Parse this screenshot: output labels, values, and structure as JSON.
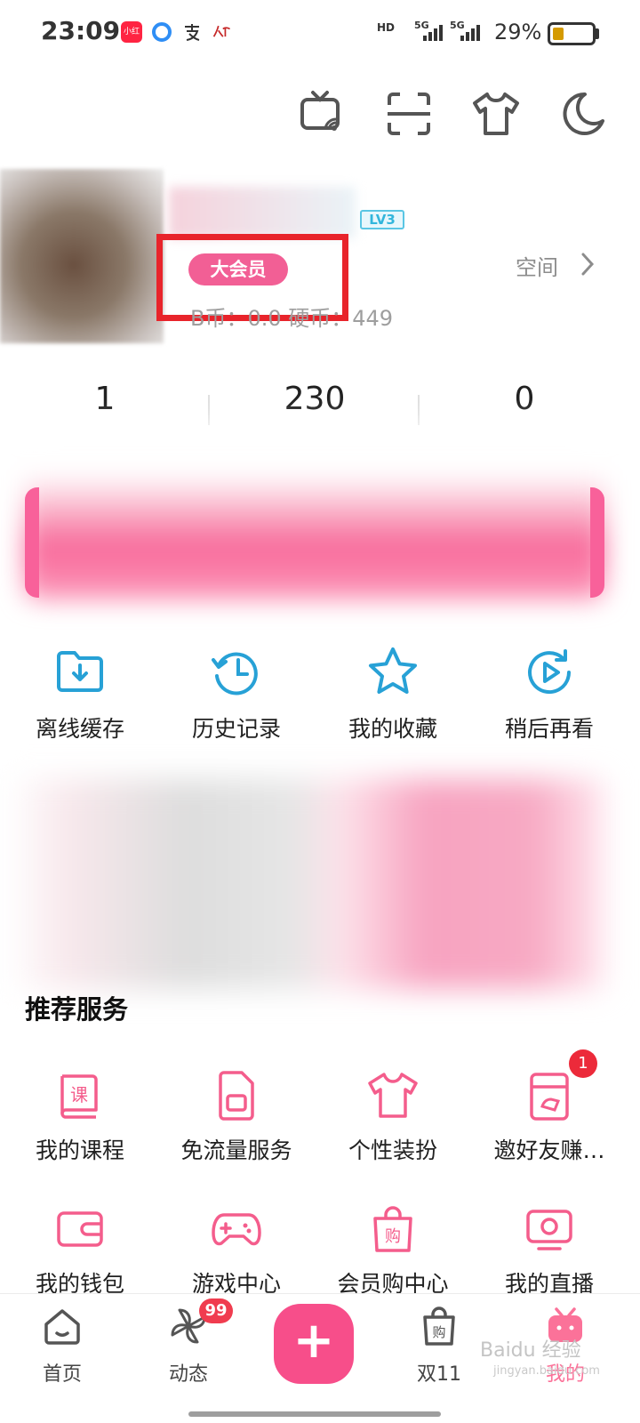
{
  "status_bar": {
    "time": "23:09",
    "battery_percent": "29%",
    "battery_level": 0.29,
    "network": [
      "HD",
      "5G",
      "5G"
    ],
    "notification_apps": [
      "小红书",
      "browser-icon",
      "alipay-icon",
      "people-daily-icon"
    ]
  },
  "top_tools": {
    "icons": [
      "tv-cast-icon",
      "scan-icon",
      "theme-shirt-icon",
      "night-mode-icon"
    ]
  },
  "profile": {
    "level": "LV3",
    "vip_label": "大会员",
    "coins_text": "B币：0.0    硬币：449",
    "space_label": "空间"
  },
  "stats": {
    "values": [
      "1",
      "230",
      "0"
    ]
  },
  "quick_actions": [
    {
      "label": "离线缓存",
      "icon": "offline-download-icon"
    },
    {
      "label": "历史记录",
      "icon": "history-icon"
    },
    {
      "label": "我的收藏",
      "icon": "favorites-star-icon"
    },
    {
      "label": "稍后再看",
      "icon": "watch-later-icon"
    }
  ],
  "services": {
    "title": "推荐服务",
    "items": [
      {
        "label": "我的课程",
        "icon": "course-icon"
      },
      {
        "label": "免流量服务",
        "icon": "sim-card-icon"
      },
      {
        "label": "个性装扮",
        "icon": "shirt-icon"
      },
      {
        "label": "邀好友赚…",
        "icon": "invite-friend-icon",
        "badge": "1"
      },
      {
        "label": "我的钱包",
        "icon": "wallet-icon"
      },
      {
        "label": "游戏中心",
        "icon": "gamepad-icon"
      },
      {
        "label": "会员购中心",
        "icon": "shopping-bag-icon"
      },
      {
        "label": "我的直播",
        "icon": "live-tv-icon"
      }
    ]
  },
  "bottom_nav": {
    "items": [
      {
        "label": "首页",
        "icon": "home-icon"
      },
      {
        "label": "动态",
        "icon": "pinwheel-icon",
        "badge": "99"
      },
      {
        "label": "",
        "icon": "plus-icon"
      },
      {
        "label": "双11",
        "icon": "shopping-bag-icon"
      },
      {
        "label": "我的",
        "icon": "tv-mascot-icon"
      }
    ],
    "active_color": "#fb7299"
  },
  "watermark": {
    "text": "Baidu 经验",
    "sub": "jingyan.baidu.com"
  },
  "colors": {
    "accent_pink": "#fb7299",
    "icon_blue": "#27a1d6",
    "highlight_red": "#e8242b"
  }
}
